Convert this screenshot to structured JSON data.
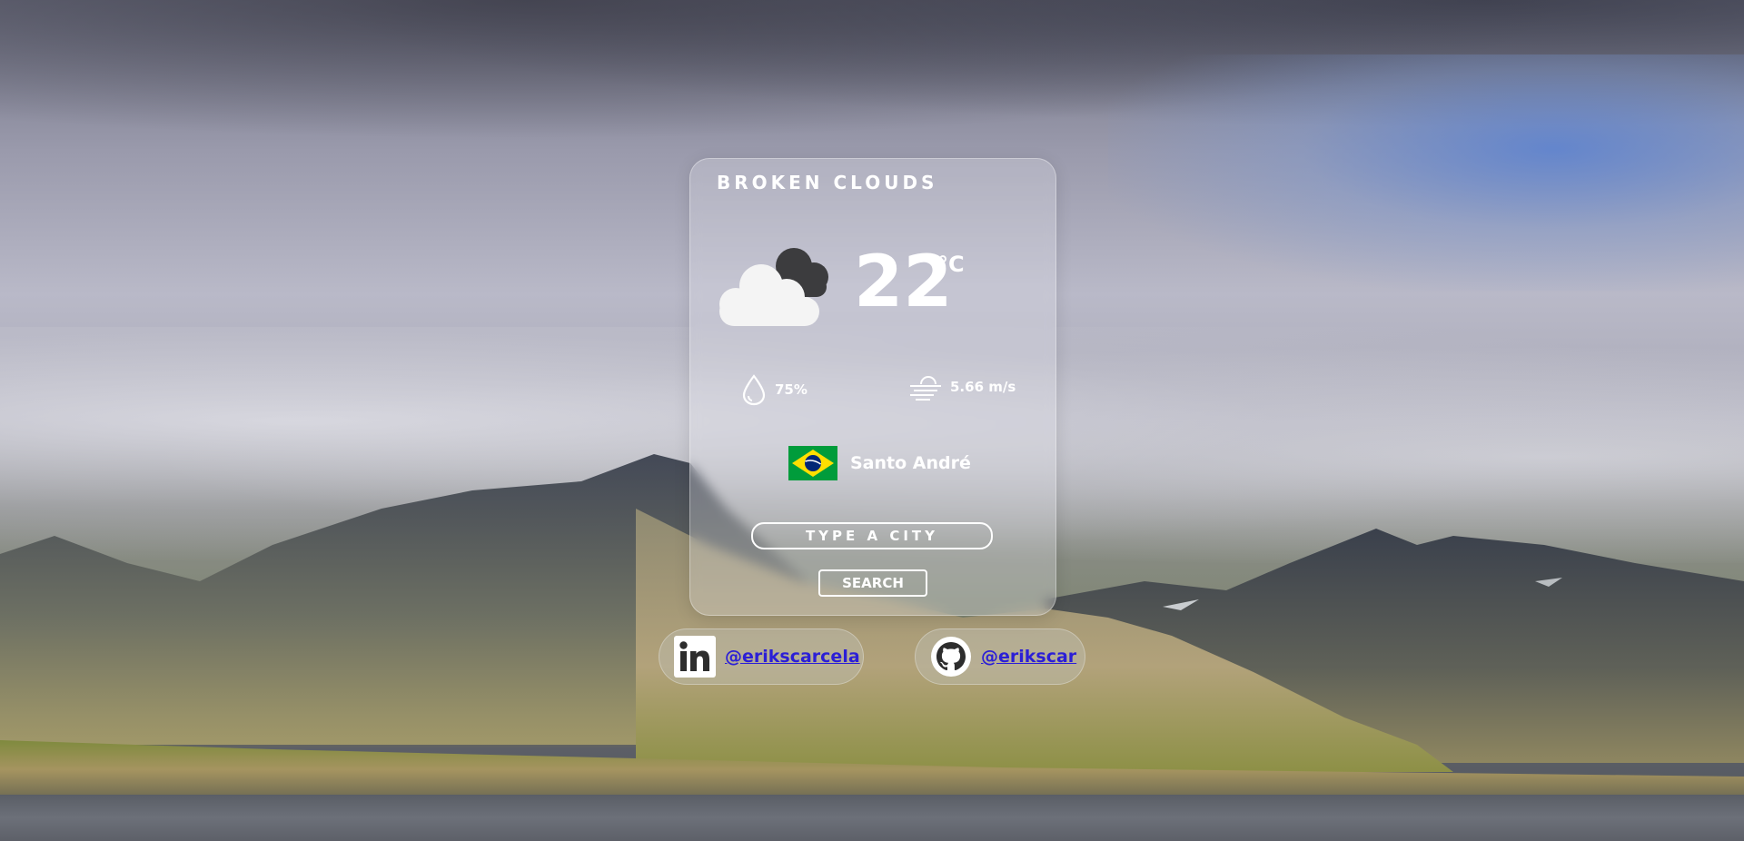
{
  "weather": {
    "description": "broken clouds",
    "temperature": "22",
    "unit": "°C",
    "humidity": "75%",
    "wind": "5.66 m/s",
    "icon": "broken-clouds-icon",
    "humidity_icon": "droplet-icon",
    "wind_icon": "wind-icon"
  },
  "location": {
    "city": "Santo André",
    "flag": "brazil-flag"
  },
  "search": {
    "placeholder": "TYPE A CITY",
    "button_label": "SEARCH"
  },
  "social": {
    "linkedin": {
      "handle": "@erikscarcela",
      "icon": "linkedin-icon"
    },
    "github": {
      "handle": "@erikscar",
      "icon": "github-icon"
    }
  },
  "colors": {
    "card_text": "#ffffff",
    "link": "#2c1fd6",
    "flag_green": "#009c3b",
    "flag_yellow": "#ffdf00",
    "flag_blue": "#002776"
  }
}
